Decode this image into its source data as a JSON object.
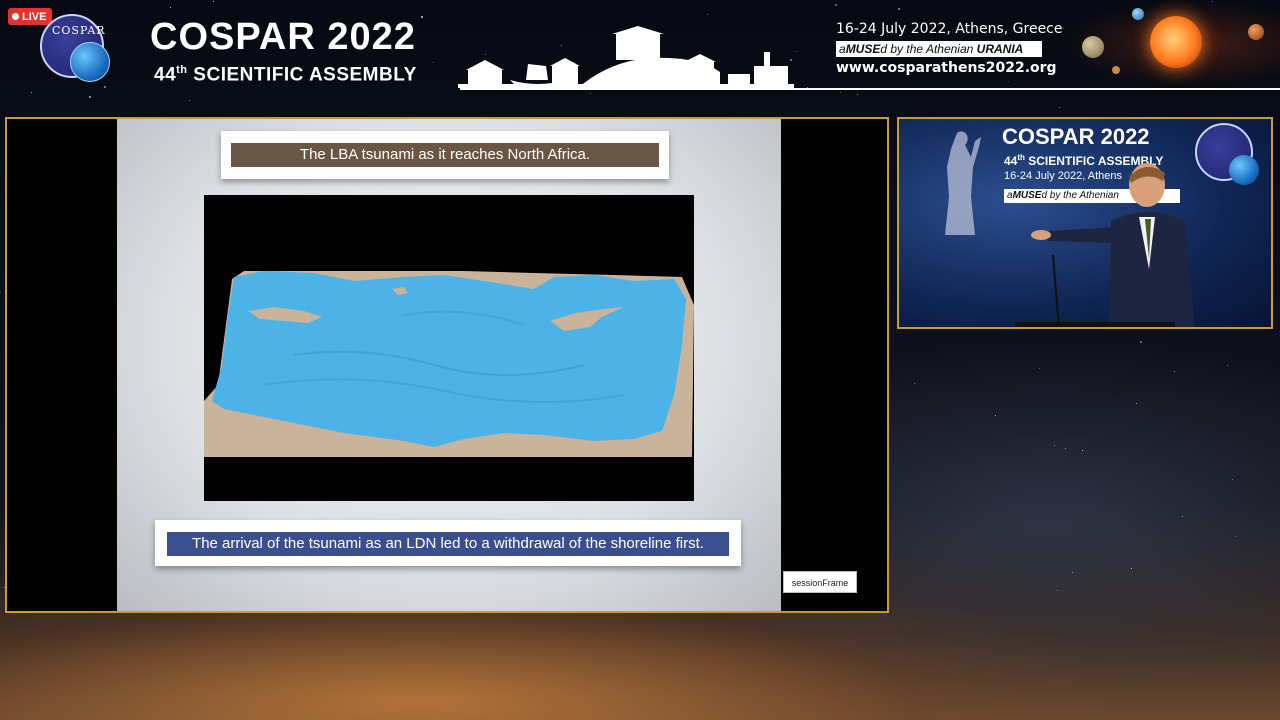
{
  "live_badge": {
    "label": "LIVE"
  },
  "header": {
    "logo_text": "COSPAR",
    "title": "COSPAR 2022",
    "subtitle_number": "44",
    "subtitle_ordinal": "th",
    "subtitle_rest": " SCIENTIFIC ASSEMBLY",
    "event_date": "16-24 July 2022, Athens, Greece",
    "amused_prefix": "a",
    "amused_brand": "MUSE",
    "amused_mid": "d by the Athenian ",
    "amused_org": "URANIA",
    "url": "www.cosparathens2022.org"
  },
  "slide": {
    "title": "The LBA tsunami as it  reaches North  Africa.",
    "caption": "The arrival of the tsunami as an LDN  led to a withdrawal of the shoreline first.",
    "colors": {
      "title_bar": "#6b5643",
      "caption_bar": "#3b4f8f",
      "sea": "#4db3e6",
      "land": "#c9b39a"
    }
  },
  "session_frame": {
    "label": "sessionFrame"
  },
  "video": {
    "title": "COSPAR 2022",
    "sub_number": "44",
    "sub_ordinal": "th",
    "sub_rest": " SCIENTIFIC ASSEMBLY",
    "date": "16-24 July 2022, Athens",
    "amused_prefix": "a",
    "amused_brand": "MUSE",
    "amused_rest": "d by the Athenian"
  }
}
